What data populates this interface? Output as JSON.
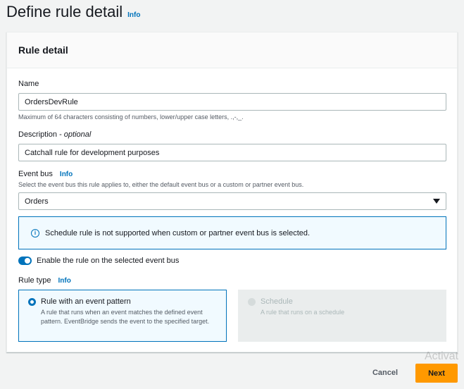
{
  "header": {
    "title": "Define rule detail",
    "info": "Info"
  },
  "panel": {
    "title": "Rule detail"
  },
  "name_field": {
    "label": "Name",
    "value": "OrdersDevRule",
    "hint": "Maximum of 64 characters consisting of numbers, lower/upper case letters, .,-,_."
  },
  "description_field": {
    "label": "Description - ",
    "label_optional": "optional",
    "value": "Catchall rule for development purposes"
  },
  "event_bus": {
    "label": "Event bus",
    "info": "Info",
    "hint": "Select the event bus this rule applies to, either the default event bus or a custom or partner event bus.",
    "selected": "Orders"
  },
  "alert": {
    "text": "Schedule rule is not supported when custom or partner event bus is selected."
  },
  "enable_toggle": {
    "label": "Enable the rule on the selected event bus",
    "on": true
  },
  "rule_type": {
    "label": "Rule type",
    "info": "Info",
    "options": [
      {
        "title": "Rule with an event pattern",
        "description": "A rule that runs when an event matches the defined event pattern. EventBridge sends the event to the specified target.",
        "selected": true,
        "disabled": false
      },
      {
        "title": "Schedule",
        "description": "A rule that runs on a schedule",
        "selected": false,
        "disabled": true
      }
    ]
  },
  "footer": {
    "cancel_label": "Cancel",
    "next_label": "Next"
  },
  "watermark": "Activat",
  "colors": {
    "accent": "#0073bb",
    "primary_button": "#ff9900",
    "background": "#f2f3f3"
  }
}
